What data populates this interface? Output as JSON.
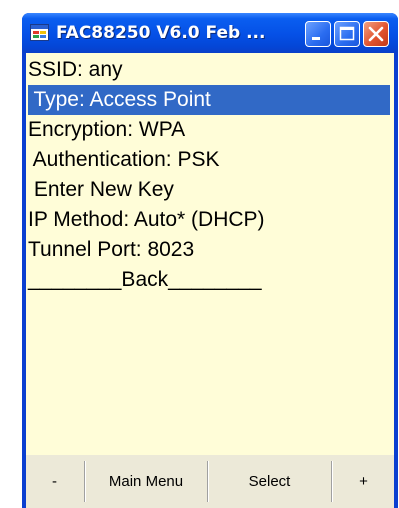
{
  "window": {
    "title": "FAC88250 V6.0 Feb ..."
  },
  "menu": {
    "items": [
      {
        "text": "SSID: any",
        "selected": false
      },
      {
        "text": " Type: Access Point",
        "selected": true
      },
      {
        "text": "Encryption: WPA",
        "selected": false
      },
      {
        "text": " Authentication: PSK",
        "selected": false
      },
      {
        "text": " Enter New Key",
        "selected": false
      },
      {
        "text": "IP Method: Auto* (DHCP)",
        "selected": false
      },
      {
        "text": "Tunnel Port: 8023",
        "selected": false
      },
      {
        "text": "________Back________",
        "selected": false
      }
    ]
  },
  "toolbar": {
    "minus_label": "-",
    "main_menu_label": "Main Menu",
    "select_label": "Select",
    "plus_label": "+"
  },
  "colors": {
    "titlebar": "#0550e6",
    "background": "#fffdd8",
    "selection": "#3169c6",
    "toolbar": "#ece9d8",
    "close_button": "#e2542f"
  },
  "icons": {
    "app": "application-icon",
    "minimize": "minimize-icon",
    "maximize": "maximize-icon",
    "close": "close-icon"
  }
}
